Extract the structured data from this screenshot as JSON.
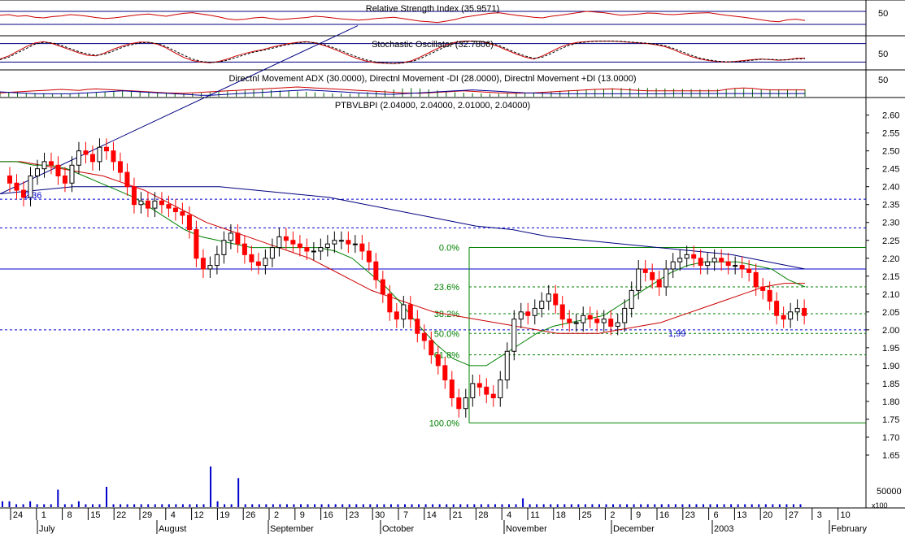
{
  "chart_data": [
    {
      "type": "line",
      "panel": "rsi",
      "title": "Relative Strength Index (35.9571)",
      "y_ticks": [
        50
      ],
      "levels": [
        70,
        30
      ],
      "ylim": [
        0,
        100
      ],
      "series": [
        {
          "color": "#cc0000",
          "values": [
            58,
            60,
            55,
            57,
            52,
            50,
            54,
            56,
            60,
            58,
            55,
            51,
            48,
            50,
            53,
            57,
            60,
            62,
            58,
            55,
            60,
            64,
            66,
            62,
            58,
            53,
            47,
            44,
            46,
            50,
            52,
            48,
            45,
            47,
            49,
            51,
            55,
            53,
            50,
            47,
            45,
            43,
            45,
            48,
            50,
            52,
            48,
            44,
            40,
            38,
            36,
            40,
            45,
            52,
            56,
            60,
            64,
            66,
            62,
            58,
            55,
            52,
            50,
            55,
            58,
            62,
            66,
            70,
            68,
            66,
            62,
            58,
            60,
            62,
            65,
            64,
            61,
            60,
            62,
            64,
            65,
            66,
            62,
            58,
            55,
            52,
            48,
            44,
            40,
            38,
            44,
            46,
            42
          ]
        }
      ]
    },
    {
      "type": "line",
      "panel": "stochastic",
      "title": "Stochastic Oscillator (32.7806)",
      "y_ticks": [
        50
      ],
      "levels": [
        80,
        20
      ],
      "ylim": [
        0,
        100
      ],
      "series": [
        {
          "color": "#cc0000",
          "style": "solid",
          "values": [
            30,
            40,
            55,
            70,
            82,
            86,
            80,
            70,
            60,
            50,
            42,
            40,
            50,
            62,
            72,
            80,
            85,
            84,
            78,
            66,
            50,
            35,
            25,
            20,
            18,
            22,
            30,
            40,
            48,
            55,
            60,
            68,
            74,
            80,
            84,
            86,
            82,
            74,
            64,
            52,
            40,
            30,
            22,
            18,
            16,
            15,
            18,
            24,
            36,
            50,
            64,
            76,
            84,
            88,
            88,
            86,
            80,
            70,
            58,
            46,
            36,
            30,
            40,
            54,
            68,
            78,
            84,
            86,
            88,
            88,
            88,
            86,
            84,
            82,
            80,
            76,
            70,
            60,
            48,
            38,
            30,
            25,
            22,
            20,
            22,
            25,
            28,
            30,
            28,
            26,
            28,
            32,
            33
          ]
        },
        {
          "color": "#000000",
          "style": "dashed",
          "values": [
            28,
            36,
            50,
            64,
            78,
            84,
            82,
            74,
            64,
            54,
            46,
            42,
            46,
            56,
            68,
            76,
            82,
            84,
            80,
            70,
            56,
            42,
            30,
            22,
            19,
            20,
            26,
            35,
            44,
            52,
            58,
            64,
            71,
            77,
            82,
            85,
            83,
            77,
            68,
            57,
            45,
            35,
            26,
            20,
            17,
            15,
            17,
            21,
            31,
            44,
            58,
            71,
            81,
            86,
            88,
            87,
            82,
            74,
            62,
            50,
            40,
            32,
            36,
            48,
            62,
            74,
            81,
            85,
            87,
            88,
            88,
            87,
            85,
            83,
            81,
            78,
            73,
            64,
            53,
            42,
            33,
            27,
            23,
            21,
            21,
            23,
            26,
            29,
            29,
            27,
            27,
            30,
            31
          ]
        }
      ]
    },
    {
      "type": "bar",
      "panel": "dmi",
      "title": "Directnl Movement ADX (30.0000), Directnl Movement -DI (28.0000), Directnl Movement +DI (13.0000)",
      "y_ticks": [
        50
      ],
      "ylim": [
        0,
        100
      ],
      "series": [
        {
          "name": "ADX",
          "color": "#006600",
          "style": "bars",
          "values": [
            22,
            20,
            18,
            16,
            15,
            14,
            13,
            12,
            12,
            14,
            16,
            18,
            20,
            22,
            24,
            22,
            20,
            18,
            16,
            15,
            14,
            13,
            14,
            16,
            18,
            20,
            22,
            24,
            26,
            28,
            30,
            28,
            26,
            24,
            22,
            20,
            18,
            16,
            14,
            13,
            12,
            14,
            18,
            22,
            26,
            30,
            34,
            36,
            34,
            30,
            26,
            22,
            18,
            16,
            14,
            13,
            12,
            12,
            13,
            14,
            16,
            18,
            20,
            22,
            24,
            26,
            28,
            30,
            32,
            33,
            34,
            35,
            36,
            36,
            36,
            35,
            34,
            33,
            32,
            31,
            30,
            30,
            31,
            32,
            33,
            32,
            31,
            30,
            30,
            30,
            30,
            30,
            30
          ]
        },
        {
          "name": "-DI",
          "color": "#cc0000",
          "style": "line",
          "values": [
            15,
            18,
            20,
            22,
            24,
            26,
            28,
            30,
            28,
            26,
            30,
            32,
            30,
            28,
            26,
            24,
            22,
            20,
            18,
            16,
            15,
            14,
            16,
            18,
            20,
            22,
            24,
            26,
            28,
            30,
            32,
            34,
            36,
            38,
            40,
            38,
            36,
            34,
            32,
            30,
            28,
            26,
            24,
            22,
            20,
            18,
            16,
            15,
            14,
            16,
            18,
            20,
            22,
            24,
            22,
            20,
            18,
            16,
            15,
            14,
            15,
            16,
            18,
            20,
            22,
            24,
            26,
            28,
            30,
            31,
            32,
            30,
            28,
            26,
            24,
            24,
            24,
            24,
            24,
            24,
            24,
            24,
            24,
            30,
            34,
            36,
            34,
            30,
            28,
            28,
            28,
            28,
            28
          ]
        },
        {
          "name": "+DI",
          "color": "#000099",
          "style": "line",
          "values": [
            20,
            18,
            16,
            14,
            12,
            12,
            12,
            12,
            12,
            14,
            16,
            18,
            20,
            22,
            24,
            22,
            20,
            18,
            16,
            14,
            12,
            10,
            8,
            6,
            6,
            8,
            10,
            12,
            14,
            16,
            18,
            20,
            22,
            24,
            26,
            28,
            26,
            24,
            22,
            20,
            18,
            16,
            14,
            12,
            10,
            10,
            12,
            14,
            16,
            18,
            20,
            22,
            24,
            26,
            28,
            26,
            24,
            22,
            20,
            18,
            16,
            15,
            14,
            13,
            12,
            12,
            12,
            12,
            12,
            12,
            12,
            12,
            12,
            12,
            12,
            12,
            12,
            13,
            13,
            13,
            13,
            13,
            13,
            13,
            13,
            13,
            13,
            13,
            13,
            13,
            13,
            13,
            13
          ]
        }
      ]
    },
    {
      "type": "candlestick",
      "panel": "price",
      "title": "PTBVLBPI (2.04000, 2.04000, 2.01000, 2.04000)",
      "y_ticks": [
        "2.60",
        "2.55",
        "2.50",
        "2.45",
        "2.40",
        "2.35",
        "2.30",
        "2.25",
        "2.20",
        "2.15",
        "2.10",
        "2.05",
        "2.00",
        "1.95",
        "1.90",
        "1.85",
        "1.80",
        "1.75",
        "1.70",
        "1.65"
      ],
      "ylim": [
        1.6,
        2.64
      ],
      "x_ticks": [
        "24",
        "1",
        "8",
        "15",
        "22",
        "29",
        "4",
        "12",
        "19",
        "26",
        "2",
        "9",
        "16",
        "23",
        "30",
        "7",
        "14",
        "21",
        "28",
        "4",
        "11",
        "18",
        "25",
        "2",
        "9",
        "16",
        "23",
        "6",
        "13",
        "20",
        "27",
        "3",
        "10"
      ],
      "months": [
        "July",
        "August",
        "September",
        "October",
        "November",
        "December",
        "2003",
        "February"
      ],
      "series": [
        {
          "name": "price",
          "close": [
            2.41,
            2.39,
            2.37,
            2.43,
            2.45,
            2.47,
            2.46,
            2.43,
            2.41,
            2.46,
            2.5,
            2.49,
            2.47,
            2.51,
            2.5,
            2.47,
            2.44,
            2.4,
            2.35,
            2.36,
            2.34,
            2.36,
            2.35,
            2.34,
            2.33,
            2.32,
            2.28,
            2.2,
            2.17,
            2.18,
            2.21,
            2.25,
            2.27,
            2.24,
            2.21,
            2.19,
            2.18,
            2.2,
            2.23,
            2.26,
            2.25,
            2.24,
            2.23,
            2.22,
            2.22,
            2.23,
            2.24,
            2.25,
            2.25,
            2.24,
            2.24,
            2.22,
            2.19,
            2.14,
            2.1,
            2.05,
            2.03,
            2.07,
            2.03,
            1.99,
            1.97,
            1.93,
            1.9,
            1.86,
            1.81,
            1.78,
            1.81,
            1.85,
            1.84,
            1.82,
            1.81,
            1.86,
            1.94,
            2.03,
            2.05,
            2.04,
            2.06,
            2.08,
            2.1,
            2.07,
            2.03,
            2.02,
            2.02,
            2.04,
            2.03,
            2.02,
            2.03,
            2.01,
            2.02,
            2.06,
            2.11,
            2.17,
            2.16,
            2.14,
            2.12,
            2.17,
            2.19,
            2.2,
            2.21,
            2.2,
            2.18,
            2.19,
            2.2,
            2.19,
            2.18,
            2.18,
            2.17,
            2.16,
            2.12,
            2.11,
            2.08,
            2.04,
            2.03,
            2.05,
            2.06,
            2.04
          ],
          "ma_short": {
            "color": "#008000",
            "values": [
              2.47,
              2.47,
              2.46,
              2.46,
              2.45,
              2.43,
              2.41,
              2.39,
              2.37,
              2.34,
              2.31,
              2.28,
              2.26,
              2.25,
              2.24,
              2.23,
              2.23,
              2.23,
              2.23,
              2.23,
              2.22,
              2.2,
              2.16,
              2.12,
              2.07,
              2.01,
              1.96,
              1.92,
              1.9,
              1.9,
              1.93,
              1.96,
              1.99,
              2.01,
              2.02,
              2.03,
              2.04,
              2.07,
              2.1,
              2.13,
              2.16,
              2.18,
              2.19,
              2.19,
              2.19,
              2.18,
              2.17,
              2.14,
              2.12
            ]
          },
          "ma_mid": {
            "color": "#cc0000",
            "values": [
              2.47,
              2.47,
              2.46,
              2.45,
              2.44,
              2.43,
              2.41,
              2.39,
              2.36,
              2.33,
              2.3,
              2.28,
              2.26,
              2.24,
              2.22,
              2.2,
              2.17,
              2.14,
              2.11,
              2.09,
              2.07,
              2.05,
              2.04,
              2.03,
              2.02,
              2.01,
              2.0,
              1.99,
              1.99,
              1.99,
              2.0,
              2.01,
              2.02,
              2.04,
              2.06,
              2.08,
              2.1,
              2.12,
              2.13,
              2.13
            ]
          },
          "ma_long": {
            "color": "#000080",
            "values": [
              2.38,
              2.39,
              2.4,
              2.4,
              2.4,
              2.4,
              2.4,
              2.39,
              2.38,
              2.37,
              2.35,
              2.33,
              2.31,
              2.29,
              2.28,
              2.26,
              2.25,
              2.24,
              2.23,
              2.22,
              2.21,
              2.19,
              2.17
            ]
          },
          "trendline": {
            "color": "#000080",
            "from": 2.38,
            "to": 2.85
          },
          "support": 2.17,
          "annotations": [
            {
              "text": "2,36"
            },
            {
              "text": "1,99"
            }
          ]
        },
        {
          "name": "volume",
          "unit": "x100",
          "tick": "50000",
          "values": [
            2,
            2,
            1,
            1,
            2,
            1,
            1,
            1,
            6,
            1,
            1,
            2,
            1,
            1,
            1,
            7,
            1,
            1,
            1,
            1,
            1,
            1,
            1,
            1,
            1,
            1,
            1,
            1,
            1,
            1,
            14,
            2,
            1,
            1,
            10,
            1,
            1,
            1,
            1,
            1,
            1,
            1,
            1,
            1,
            1,
            1,
            1,
            1,
            1,
            1,
            1,
            1,
            1,
            1,
            1,
            1,
            1,
            1,
            1,
            1,
            1,
            1,
            1,
            1,
            1,
            1,
            1,
            1,
            1,
            1,
            1,
            1,
            1,
            1,
            1,
            3,
            1,
            1,
            1,
            1,
            1,
            1,
            1,
            1,
            1,
            1,
            1,
            1,
            1,
            1,
            1,
            1,
            1,
            1,
            1,
            1,
            1,
            1,
            1,
            1,
            1,
            1,
            1,
            1,
            1,
            1,
            1,
            1,
            1,
            1,
            1,
            1,
            1,
            1,
            1,
            1
          ]
        }
      ],
      "fibonacci": [
        {
          "label": "0.0%",
          "value": 2.23
        },
        {
          "label": "23.6%",
          "value": 2.12
        },
        {
          "label": "38.2%",
          "value": 2.045
        },
        {
          "label": "50.0%",
          "value": 1.99
        },
        {
          "label": "61.8%",
          "value": 1.93
        },
        {
          "label": "100.0%",
          "value": 1.74
        }
      ],
      "horizontal_dashed": [
        2.365,
        2.285,
        2.0
      ],
      "colors": {
        "up": "#ffffff",
        "down": "#ff0000",
        "axis": "#000000",
        "fib": "#008000",
        "blue": "#0000ff",
        "panel_line": "#000080"
      }
    }
  ]
}
